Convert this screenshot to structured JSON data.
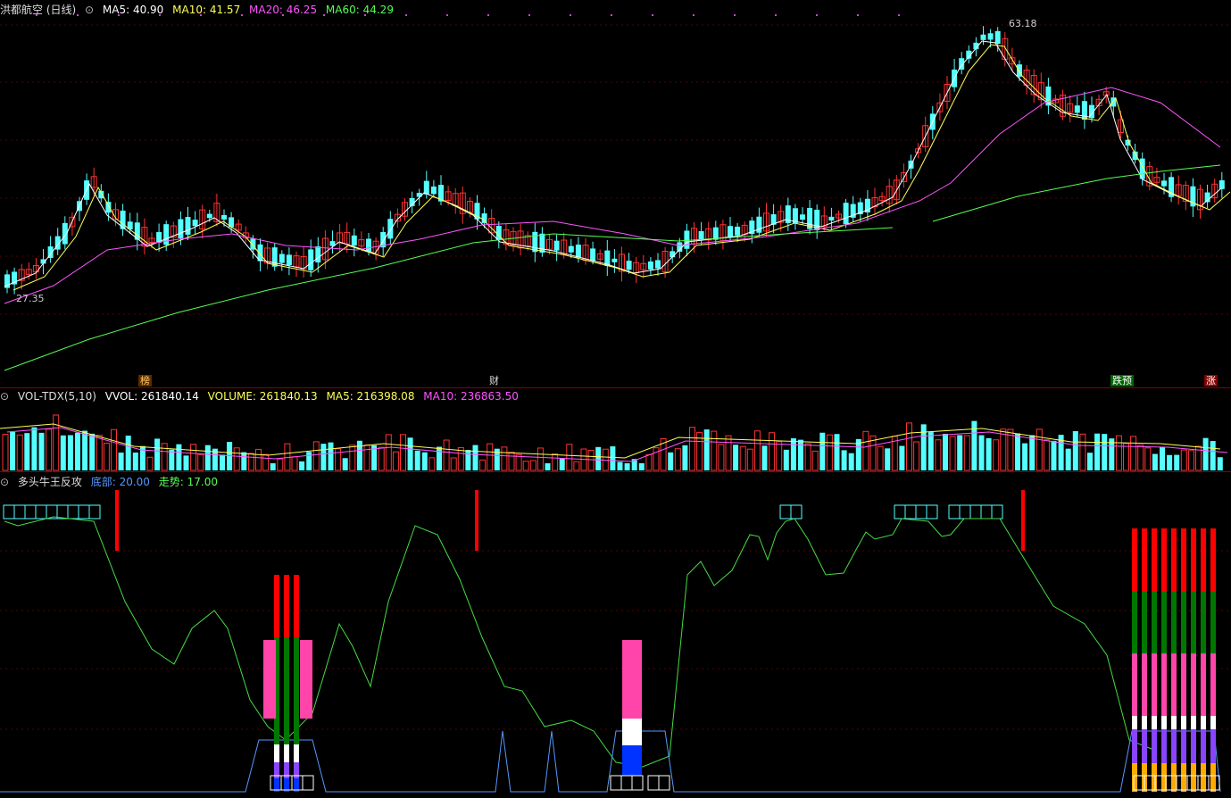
{
  "price_panel": {
    "title": "洪都航空 (日线)",
    "ma5": "MA5: 40.90",
    "ma10": "MA10: 41.57",
    "ma20": "MA20: 46.25",
    "ma60": "MA60: 44.29",
    "high_label": "63.18",
    "low_label": "27.35",
    "markers": [
      "榜",
      "财",
      "跌预",
      "涨"
    ],
    "colors": {
      "ma5": "#ffffff",
      "ma10": "#ffff55",
      "ma20": "#ff55ff",
      "ma60": "#55ff55",
      "up": "#ff3333",
      "down": "#55ffff"
    }
  },
  "volume_panel": {
    "title": "VOL-TDX(5,10)",
    "vvol": "VVOL: 261840.14",
    "volume": "VOLUME: 261840.13",
    "ma5": "MA5: 216398.08",
    "ma10": "MA10: 236863.50"
  },
  "indicator_panel": {
    "title": "多头牛王反攻",
    "bottom": "底部: 20.00",
    "trend": "走势: 17.00"
  }
}
